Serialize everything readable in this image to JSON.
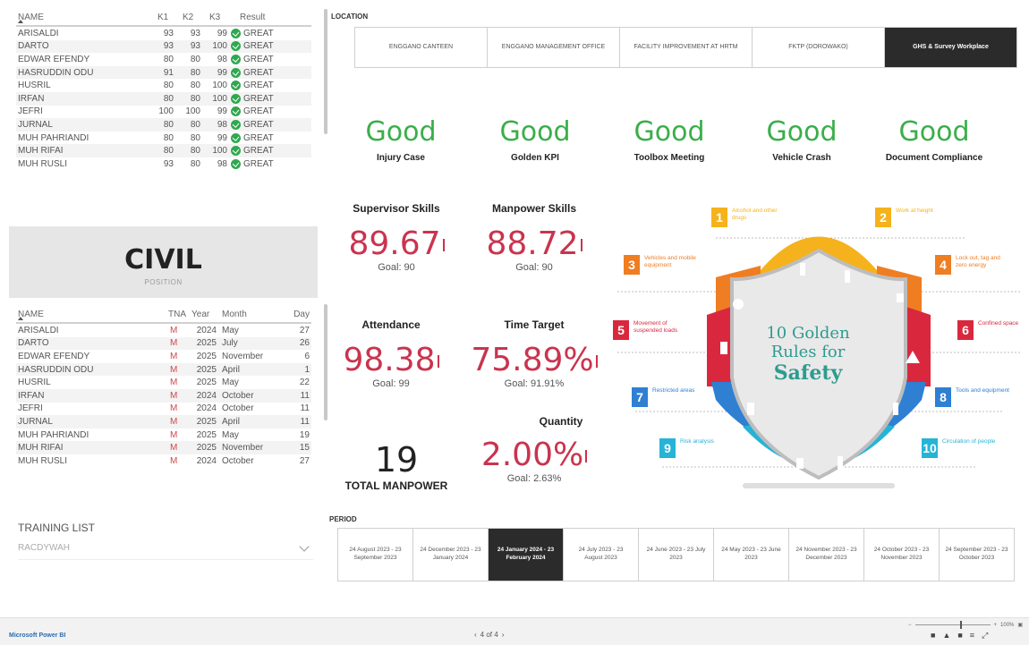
{
  "kpi_table": {
    "headers": {
      "name": "NAME",
      "k1": "K1",
      "k2": "K2",
      "k3": "K3",
      "result": "Result"
    },
    "rows": [
      {
        "name": "ARISALDI",
        "k1": "93",
        "k2": "93",
        "k3": "99",
        "result": "GREAT"
      },
      {
        "name": "DARTO",
        "k1": "93",
        "k2": "93",
        "k3": "100",
        "result": "GREAT"
      },
      {
        "name": "EDWAR EFENDY",
        "k1": "80",
        "k2": "80",
        "k3": "98",
        "result": "GREAT"
      },
      {
        "name": "HASRUDDIN ODU",
        "k1": "91",
        "k2": "80",
        "k3": "99",
        "result": "GREAT"
      },
      {
        "name": "HUSRIL",
        "k1": "80",
        "k2": "80",
        "k3": "100",
        "result": "GREAT"
      },
      {
        "name": "IRFAN",
        "k1": "80",
        "k2": "80",
        "k3": "100",
        "result": "GREAT"
      },
      {
        "name": "JEFRI",
        "k1": "100",
        "k2": "100",
        "k3": "99",
        "result": "GREAT"
      },
      {
        "name": "JURNAL",
        "k1": "80",
        "k2": "80",
        "k3": "98",
        "result": "GREAT"
      },
      {
        "name": "MUH PAHRIANDI",
        "k1": "80",
        "k2": "80",
        "k3": "99",
        "result": "GREAT"
      },
      {
        "name": "MUH RIFAI",
        "k1": "80",
        "k2": "80",
        "k3": "100",
        "result": "GREAT"
      },
      {
        "name": "MUH RUSLI",
        "k1": "93",
        "k2": "80",
        "k3": "98",
        "result": "GREAT"
      }
    ]
  },
  "position_card": {
    "value": "CIVIL",
    "label": "POSITION"
  },
  "training_table": {
    "headers": {
      "name": "NAME",
      "tna": "TNA",
      "year": "Year",
      "month": "Month",
      "day": "Day"
    },
    "rows": [
      {
        "name": "ARISALDI",
        "tna": "M",
        "year": "2024",
        "month": "May",
        "day": "27"
      },
      {
        "name": "DARTO",
        "tna": "M",
        "year": "2025",
        "month": "July",
        "day": "26"
      },
      {
        "name": "EDWAR EFENDY",
        "tna": "M",
        "year": "2025",
        "month": "November",
        "day": "6"
      },
      {
        "name": "HASRUDDIN ODU",
        "tna": "M",
        "year": "2025",
        "month": "April",
        "day": "1"
      },
      {
        "name": "HUSRIL",
        "tna": "M",
        "year": "2025",
        "month": "May",
        "day": "22"
      },
      {
        "name": "IRFAN",
        "tna": "M",
        "year": "2024",
        "month": "October",
        "day": "11"
      },
      {
        "name": "JEFRI",
        "tna": "M",
        "year": "2024",
        "month": "October",
        "day": "11"
      },
      {
        "name": "JURNAL",
        "tna": "M",
        "year": "2025",
        "month": "April",
        "day": "11"
      },
      {
        "name": "MUH PAHRIANDI",
        "tna": "M",
        "year": "2025",
        "month": "May",
        "day": "19"
      },
      {
        "name": "MUH RIFAI",
        "tna": "M",
        "year": "2025",
        "month": "November",
        "day": "15"
      },
      {
        "name": "MUH RUSLI",
        "tna": "M",
        "year": "2024",
        "month": "October",
        "day": "27"
      }
    ]
  },
  "training_list": {
    "label": "TRAINING LIST",
    "selected": "RACDYWAH"
  },
  "location": {
    "label": "LOCATION",
    "options": [
      "ENGGANO CANTEEN",
      "ENGGANO MANAGEMENT OFFICE",
      "FACILITY IMPROVEMENT AT HRTM",
      "FKTP (DOROWAKO)",
      "GHS & Survey Workplace"
    ],
    "active_index": 4
  },
  "status_row": [
    {
      "value": "Good",
      "label": "Injury Case"
    },
    {
      "value": "Good",
      "label": "Golden KPI"
    },
    {
      "value": "Good",
      "label": "Toolbox Meeting"
    },
    {
      "value": "Good",
      "label": "Vehicle Crash"
    },
    {
      "value": "Good",
      "label": "Document Compliance"
    }
  ],
  "kpis": {
    "supervisor": {
      "title": "Supervisor Skills",
      "value": "89.67",
      "goal": "Goal: 90"
    },
    "manpower_skills": {
      "title": "Manpower Skills",
      "value": "88.72",
      "goal": "Goal: 90"
    },
    "attendance": {
      "title": "Attendance",
      "value": "98.38",
      "goal": "Goal: 99"
    },
    "time_target": {
      "title": "Time Target",
      "value": "75.89%",
      "goal": "Goal: 91.91%"
    },
    "quantity": {
      "title": "Quantity",
      "value": "2.00%",
      "goal": "Goal: 2.63%"
    }
  },
  "total_manpower": {
    "value": "19",
    "label": "TOTAL MANPOWER"
  },
  "period": {
    "label": "PERIOD",
    "options": [
      "24 August 2023 - 23 September 2023",
      "24 December 2023 - 23 January 2024",
      "24 January 2024 - 23 February 2024",
      "24 July 2023 - 23 August 2023",
      "24 June 2023 - 23 July 2023",
      "24 May 2023 - 23 June 2023",
      "24 November 2023 - 23 December 2023",
      "24 October 2023 - 23 November 2023",
      "24 September 2023 - 23 October 2023"
    ],
    "active_index": 2
  },
  "golden_rules": {
    "title_line1": "10 Golden",
    "title_line2": "Rules for",
    "title_line3": "Safety",
    "rules": [
      {
        "num": "1",
        "text": "Alcohol and other drugs",
        "color": "#f5b21c"
      },
      {
        "num": "2",
        "text": "Work at height",
        "color": "#f5b21c"
      },
      {
        "num": "3",
        "text": "Vehicles and mobile equipment",
        "color": "#ef7d22"
      },
      {
        "num": "4",
        "text": "Lock out, tag and zero energy",
        "color": "#ef7d22"
      },
      {
        "num": "5",
        "text": "Movement of suspended loads",
        "color": "#d9283e"
      },
      {
        "num": "6",
        "text": "Confined space",
        "color": "#d9283e"
      },
      {
        "num": "7",
        "text": "Restricted areas",
        "color": "#2f7fd3"
      },
      {
        "num": "8",
        "text": "Tools and equipment",
        "color": "#2f7fd3"
      },
      {
        "num": "9",
        "text": "Risk analysis",
        "color": "#25b4d6"
      },
      {
        "num": "10",
        "text": "Circulation of people",
        "color": "#25b4d6"
      }
    ]
  },
  "footer": {
    "brand": "Microsoft Power BI",
    "page": "4 of 4",
    "zoom": "100%"
  }
}
